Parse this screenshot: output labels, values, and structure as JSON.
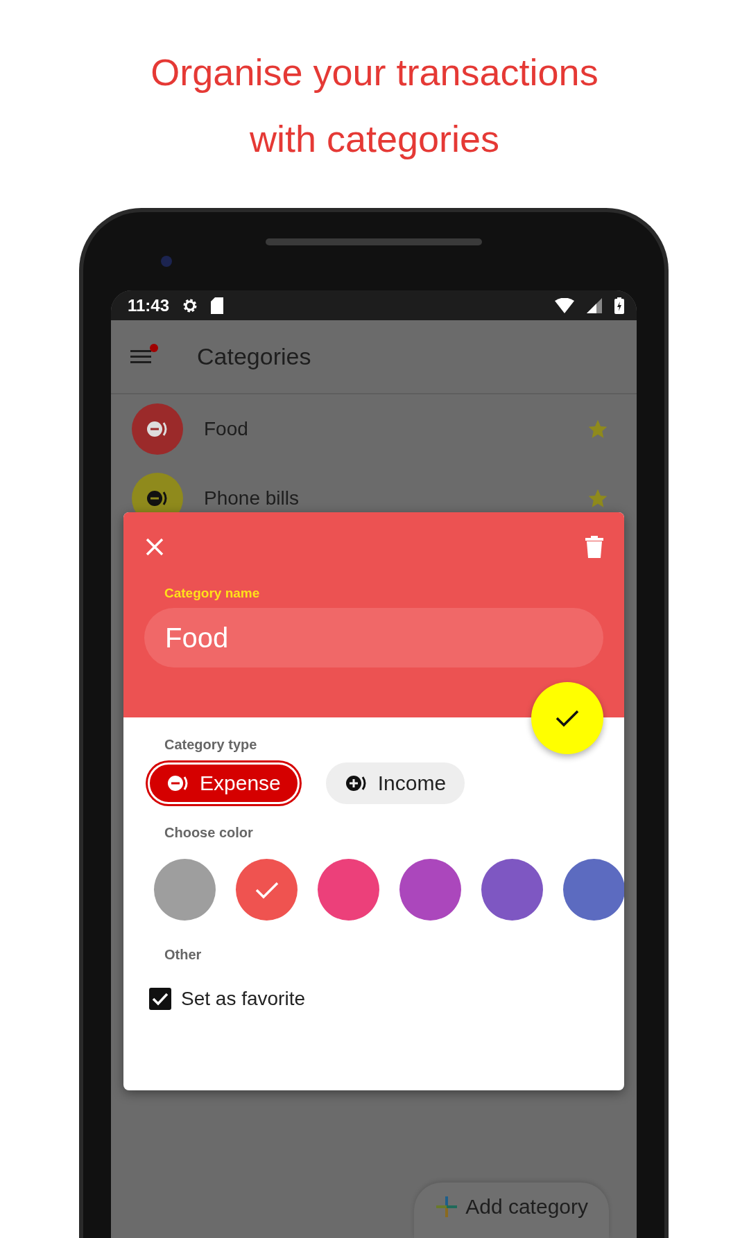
{
  "headline": "Organise your transactions with categories",
  "status_bar": {
    "time": "11:43"
  },
  "app_bar": {
    "title": "Categories",
    "menu_badge": true
  },
  "categories": [
    {
      "name": "Food",
      "color": "#9b2a2a",
      "kind": "expense",
      "favorite": true
    },
    {
      "name": "Phone bills",
      "color": "#8f8a1c",
      "kind": "expense",
      "favorite": true
    }
  ],
  "dialog": {
    "name_label": "Category name",
    "name_value": "Food",
    "type_label": "Category type",
    "types": [
      {
        "label": "Expense",
        "kind": "expense",
        "selected": true
      },
      {
        "label": "Income",
        "kind": "income",
        "selected": false
      }
    ],
    "color_label": "Choose color",
    "colors": [
      {
        "color": "#9e9e9e",
        "selected": false
      },
      {
        "color": "#ef5350",
        "selected": true
      },
      {
        "color": "#ec407a",
        "selected": false
      },
      {
        "color": "#ab47bc",
        "selected": false
      },
      {
        "color": "#7e57c2",
        "selected": false
      },
      {
        "color": "#5c6bc0",
        "selected": false
      }
    ],
    "other_label": "Other",
    "favorite": {
      "label": "Set as favorite",
      "checked": true
    }
  },
  "add_button": "Add category"
}
